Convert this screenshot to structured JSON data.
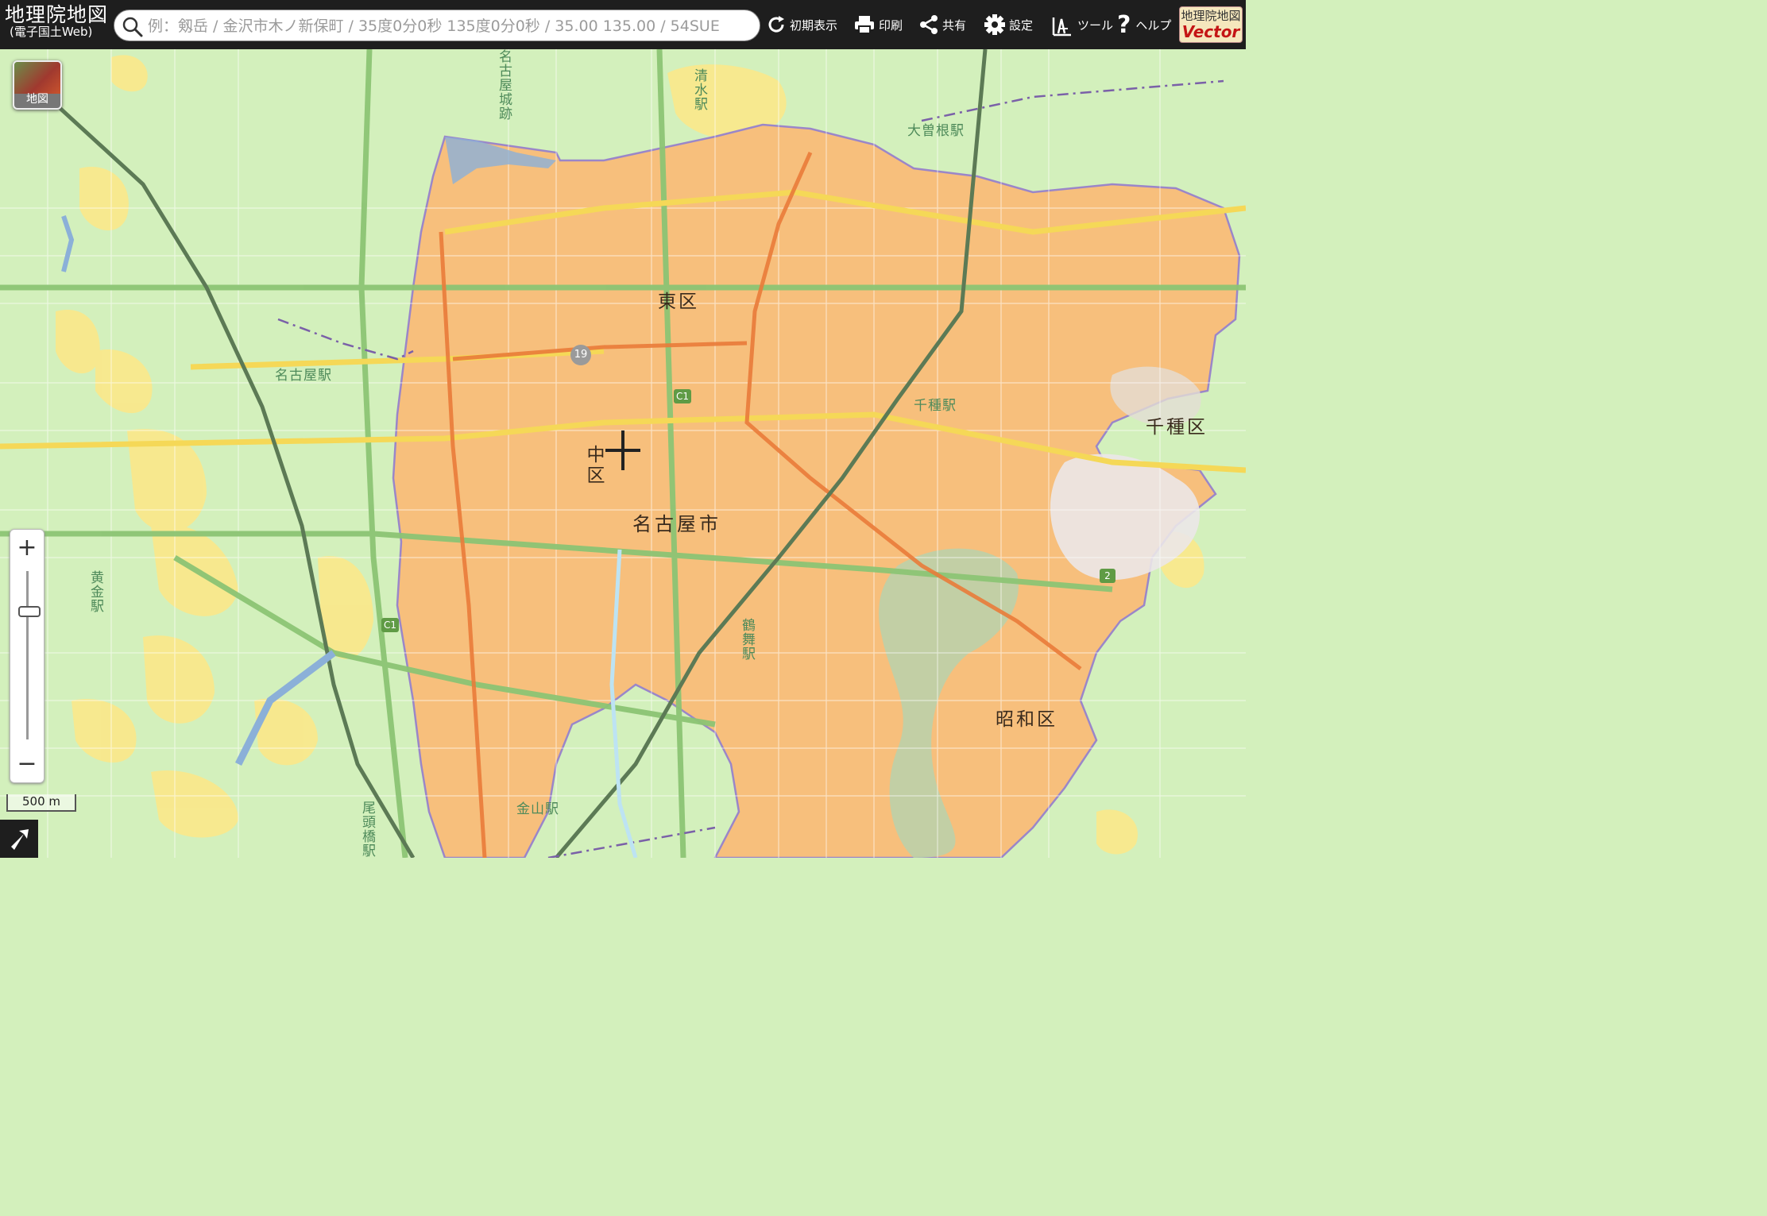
{
  "brand": {
    "title": "地理院地図",
    "subtitle": "(電子国土Web)"
  },
  "search": {
    "placeholder": "例：剱岳 / 金沢市木ノ新保町 / 35度0分0秒 135度0分0秒 / 35.00 135.00 / 54SUE"
  },
  "toolbar": [
    {
      "label": "初期表示",
      "icon": "reload-icon"
    },
    {
      "label": "印刷",
      "icon": "printer-icon"
    },
    {
      "label": "共有",
      "icon": "share-icon"
    },
    {
      "label": "設定",
      "icon": "gear-icon"
    },
    {
      "label": "ツール",
      "icon": "tools-icon"
    },
    {
      "label": "ヘルプ",
      "icon": "help-icon"
    }
  ],
  "vector_badge": {
    "line1": "地理院地図",
    "line2": "Vector"
  },
  "layer_button": {
    "label": "地図"
  },
  "zoom": {
    "plus": "+",
    "minus": "−"
  },
  "scale": {
    "label": "500 m"
  },
  "map_labels": {
    "higashi_ku": "東区",
    "naka_ku": "中区",
    "chikusa_ku": "千種区",
    "showa_ku": "昭和区",
    "nagoya_shi": "名古屋市",
    "nagoya_station": "名古屋駅",
    "chikusa_station": "千種駅",
    "ozone_station": "大曽根駅",
    "kanayama_station": "金山駅",
    "shimizu_station": "清水駅",
    "tsurumai_station": "鶴舞駅",
    "kogane_station": "黄金駅",
    "ozu_bashi_station": "尾頭橋駅",
    "nagoya_castle": "名古屋城跡",
    "route_19": "19",
    "route_c1_a": "C1",
    "route_c1_b": "C1",
    "route_2": "2"
  },
  "colors": {
    "urban_fill": "#f7bf7c",
    "base_green": "#d3f0bc",
    "yellow_fill": "#fbe88a",
    "header_bg": "#1e1e1e"
  }
}
